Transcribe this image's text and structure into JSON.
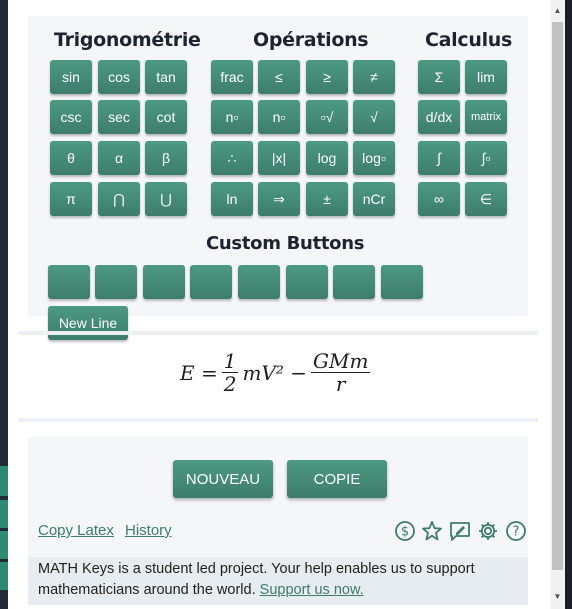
{
  "headings": {
    "trig": "Trigonométrie",
    "ops": "Opérations",
    "calc": "Calculus",
    "custom": "Custom Buttons"
  },
  "trig_keys": [
    "sin",
    "cos",
    "tan",
    "csc",
    "sec",
    "cot",
    "θ",
    "α",
    "β",
    "π",
    "⋂",
    "⋃"
  ],
  "op_keys": [
    "frac",
    "≤",
    "≥",
    "≠",
    "n▫",
    "n▫",
    "▫√",
    "√",
    "∴",
    "|x|",
    "log",
    "log▫",
    "ln",
    "⇒",
    "±",
    "nCr"
  ],
  "calc_keys": [
    "Σ",
    "lim",
    "d/dx",
    "matrix",
    "∫",
    "∫▫",
    "∞",
    "∈"
  ],
  "new_line": "New Line",
  "equation": {
    "lhs": "E =",
    "f1_num": "1",
    "f1_den": "2",
    "mid": "mV² −",
    "f2_num": "GMm",
    "f2_den": "r"
  },
  "buttons": {
    "nouveau": "NOUVEAU",
    "copie": "COPIE"
  },
  "links": {
    "copy_latex": "Copy Latex",
    "history": "History"
  },
  "icons": [
    "dollar-circle-icon",
    "star-icon",
    "feedback-icon",
    "gear-icon",
    "help-icon"
  ],
  "notice": {
    "text": "MATH Keys is a student led project. Your help enables us to support mathematicians around the world.",
    "link": "Support us now."
  },
  "colors": {
    "accent": "#3d7d6b",
    "link": "#3b7c6b"
  }
}
